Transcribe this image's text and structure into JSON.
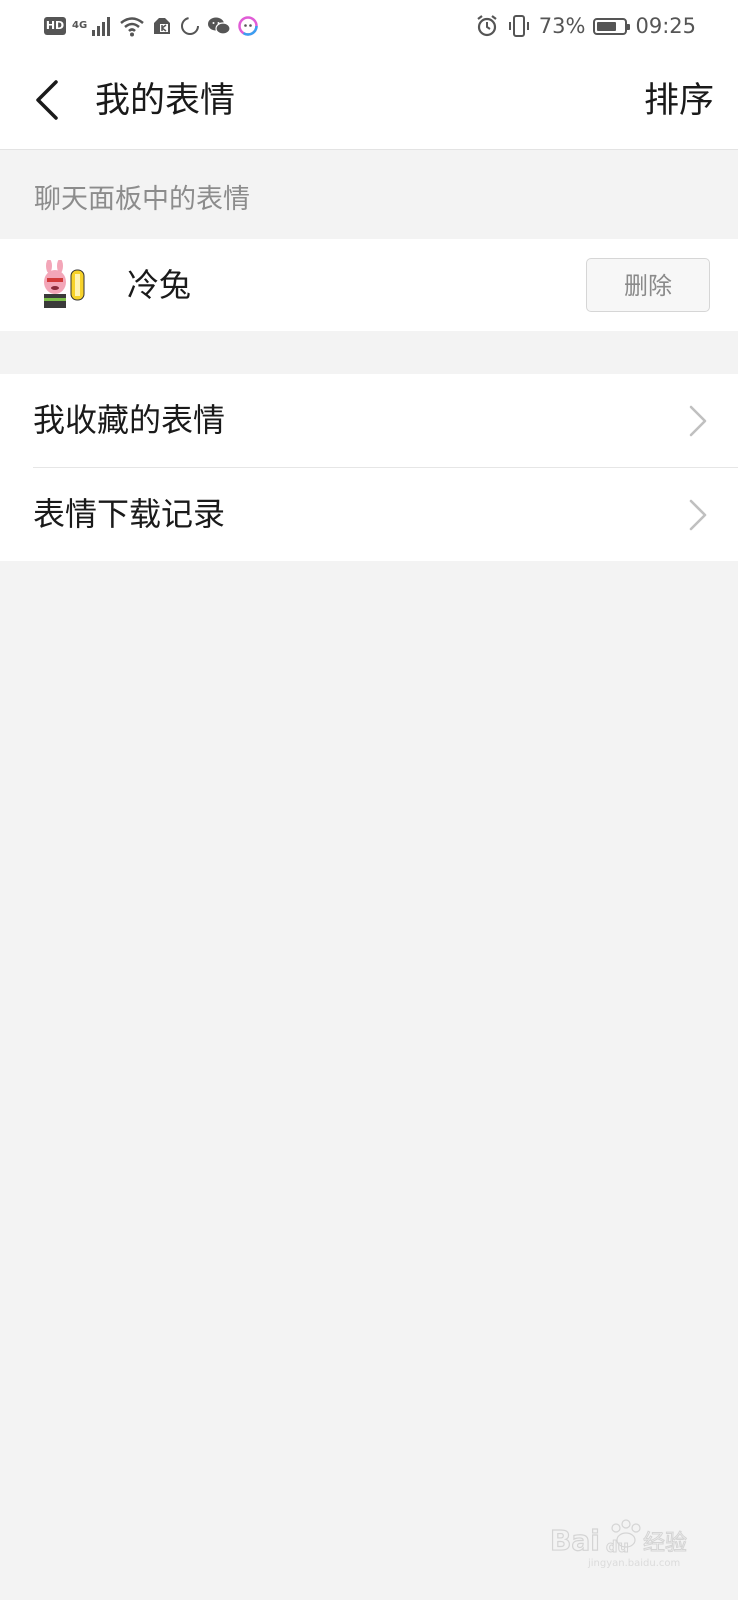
{
  "status_bar": {
    "hd": "HD",
    "network": "4G",
    "battery_text": "73%",
    "battery_level": 0.73,
    "time": "09:25",
    "icons": [
      "signal-icon",
      "wifi-icon",
      "app-notification-icon",
      "loading-icon",
      "wechat-icon",
      "chat-icon",
      "alarm-icon",
      "vibrate-icon",
      "battery-icon"
    ]
  },
  "header": {
    "title": "我的表情",
    "sort_label": "排序"
  },
  "chat_panel": {
    "section_label": "聊天面板中的表情",
    "items": [
      {
        "name": "冷兔",
        "delete_label": "删除"
      }
    ]
  },
  "menu": {
    "items": [
      {
        "label": "我收藏的表情"
      },
      {
        "label": "表情下载记录"
      }
    ]
  },
  "colors": {
    "background": "#f3f3f3",
    "surface": "#ffffff",
    "text_primary": "#1a1a1a",
    "text_secondary": "#8c8c8c",
    "chevron": "#c0c0c0"
  }
}
